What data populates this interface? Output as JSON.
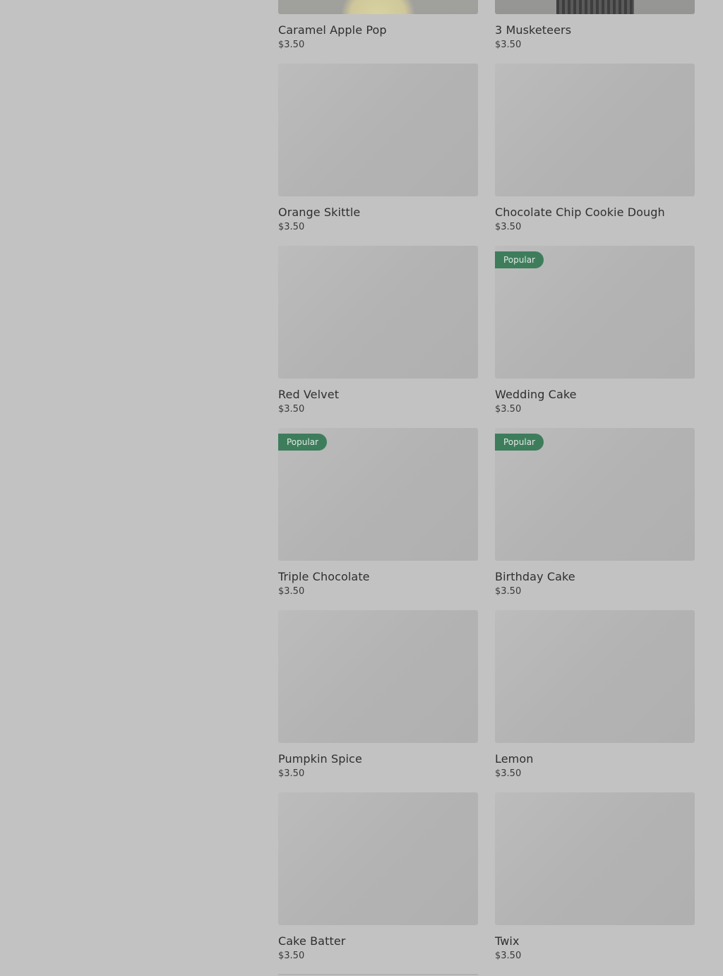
{
  "menu": {
    "items": [
      {
        "name": "Caramel Apple Pop",
        "price": "$3.50",
        "badge": "",
        "image": "photo-cupcake-yellow"
      },
      {
        "name": "3 Musketeers",
        "price": "$3.50",
        "badge": "",
        "image": "photo-cupcake-dark"
      },
      {
        "name": "Orange Skittle",
        "price": "$3.50",
        "badge": "",
        "image": ""
      },
      {
        "name": "Chocolate Chip Cookie Dough",
        "price": "$3.50",
        "badge": "",
        "image": ""
      },
      {
        "name": "Red Velvet",
        "price": "$3.50",
        "badge": "",
        "image": ""
      },
      {
        "name": "Wedding Cake",
        "price": "$3.50",
        "badge": "Popular",
        "image": ""
      },
      {
        "name": "Triple Chocolate",
        "price": "$3.50",
        "badge": "Popular",
        "image": ""
      },
      {
        "name": "Birthday Cake",
        "price": "$3.50",
        "badge": "Popular",
        "image": ""
      },
      {
        "name": "Pumpkin Spice",
        "price": "$3.50",
        "badge": "",
        "image": ""
      },
      {
        "name": "Lemon",
        "price": "$3.50",
        "badge": "",
        "image": ""
      },
      {
        "name": "Cake Batter",
        "price": "$3.50",
        "badge": "",
        "image": ""
      },
      {
        "name": "Twix",
        "price": "$3.50",
        "badge": "",
        "image": ""
      }
    ]
  },
  "colors": {
    "background": "#c2c2c2",
    "badge": "#3e7d5c",
    "text": "#2f2f2f"
  }
}
